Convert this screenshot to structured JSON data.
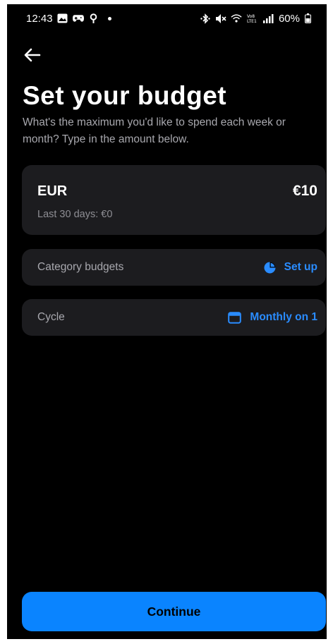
{
  "status_bar": {
    "time": "12:43",
    "battery": "60%",
    "left_icons": [
      "gallery-icon",
      "game-controller-icon",
      "location-pin-icon",
      "dot-icon"
    ],
    "right_icons": [
      "bluetooth-icon",
      "mute-icon",
      "wifi-icon",
      "volte-icon",
      "signal-icon",
      "battery-icon"
    ],
    "volte_text": "Vo8\nLTE1"
  },
  "header": {
    "back_icon": "arrow-left-icon",
    "title": "Set your budget",
    "subtitle": "What's the maximum you'd like to spend each week or month? Type in the amount below."
  },
  "amount_card": {
    "currency": "EUR",
    "amount": "€10",
    "last_period": "Last 30 days: €0"
  },
  "category_row": {
    "label": "Category budgets",
    "action_label": "Set up",
    "icon": "pie-chart-icon"
  },
  "cycle_row": {
    "label": "Cycle",
    "action_label": "Monthly on 1",
    "icon": "calendar-icon"
  },
  "footer": {
    "continue_label": "Continue"
  },
  "colors": {
    "background": "#000000",
    "card": "#1c1c1f",
    "accent": "#0a84ff",
    "link": "#2a8cff",
    "muted_text": "#a8a8ae"
  }
}
